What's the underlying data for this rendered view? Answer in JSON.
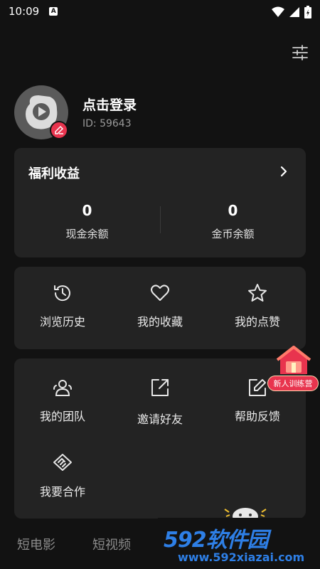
{
  "status_bar": {
    "time": "10:09",
    "notification_badge": "A"
  },
  "profile": {
    "login_label": "点击登录",
    "user_id": "ID: 59643"
  },
  "welfare": {
    "title": "福利收益",
    "cash": {
      "value": "0",
      "label": "现金余额"
    },
    "coins": {
      "value": "0",
      "label": "金币余额"
    }
  },
  "shortcuts": [
    {
      "label": "浏览历史",
      "icon": "history-icon"
    },
    {
      "label": "我的收藏",
      "icon": "heart-icon"
    },
    {
      "label": "我的点赞",
      "icon": "star-icon"
    }
  ],
  "tools": [
    {
      "label": "我的团队",
      "icon": "team-icon"
    },
    {
      "label": "邀请好友",
      "icon": "share-icon"
    },
    {
      "label": "帮助反馈",
      "icon": "edit-icon"
    },
    {
      "label": "我要合作",
      "icon": "handshake-icon"
    }
  ],
  "camp_badge": {
    "label": "新人训练营"
  },
  "bottom_nav": {
    "items": [
      "短电影",
      "短视频"
    ]
  },
  "watermark": {
    "main": "592软件园",
    "sub": "www.592xiazai.com"
  },
  "colors": {
    "background": "#121212",
    "card": "#232323",
    "accent": "#e8344e",
    "watermark": "#2e7fe6"
  }
}
